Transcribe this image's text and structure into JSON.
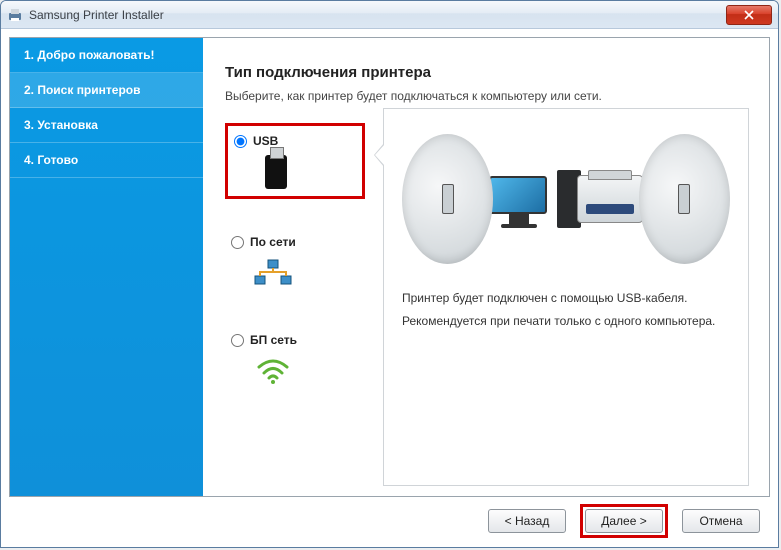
{
  "window": {
    "title": "Samsung Printer Installer"
  },
  "sidebar": {
    "steps": [
      {
        "label": "1. Добро пожаловать!"
      },
      {
        "label": "2. Поиск принтеров"
      },
      {
        "label": "3. Установка"
      },
      {
        "label": "4. Готово"
      }
    ]
  },
  "main": {
    "heading": "Тип подключения принтера",
    "subtitle": "Выберите, как принтер будет подключаться к компьютеру или сети.",
    "options": [
      {
        "label": "USB"
      },
      {
        "label": "По сети"
      },
      {
        "label": "БП сеть"
      }
    ],
    "detail": {
      "line1": "Принтер будет подключен с помощью USB-кабеля.",
      "line2": "Рекомендуется при печати только с одного компьютера."
    }
  },
  "footer": {
    "back": "< Назад",
    "next": "Далее >",
    "cancel": "Отмена"
  }
}
